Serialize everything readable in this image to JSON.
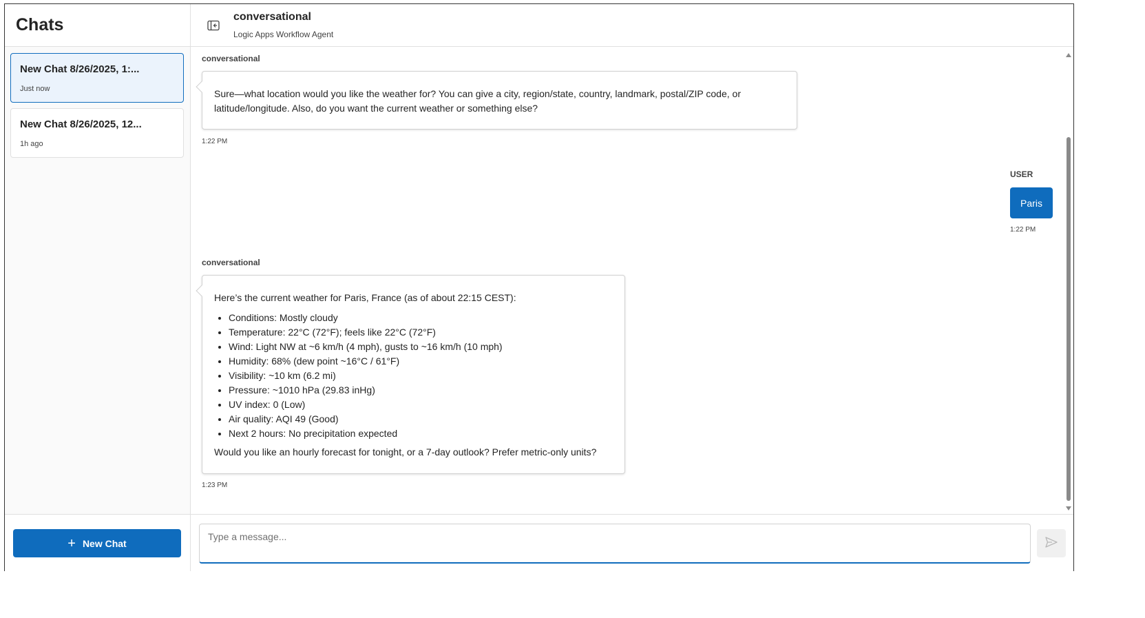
{
  "sidebar": {
    "title": "Chats",
    "chats": [
      {
        "title": "New Chat 8/26/2025, 1:...",
        "time": "Just now",
        "active": true
      },
      {
        "title": "New Chat 8/26/2025, 12...",
        "time": "1h ago",
        "active": false
      }
    ],
    "new_chat_label": "New Chat"
  },
  "header": {
    "title": "conversational",
    "subtitle": "Logic Apps Workflow Agent"
  },
  "messages": [
    {
      "sender": "conversational",
      "text": "Sure—what location would you like the weather for? You can give a city, region/state, country, landmark, postal/ZIP code, or latitude/longitude. Also, do you want the current weather or something else?",
      "time": "1:22 PM"
    },
    {
      "sender": "USER",
      "text": "Paris",
      "time": "1:22 PM"
    },
    {
      "sender": "conversational",
      "intro": "Here’s the current weather for Paris, France (as of about 22:15 CEST):",
      "bullets": [
        "Conditions: Mostly cloudy",
        "Temperature: 22°C (72°F); feels like 22°C (72°F)",
        "Wind: Light NW at ~6 km/h (4 mph), gusts to ~16 km/h (10 mph)",
        "Humidity: 68% (dew point ~16°C / 61°F)",
        "Visibility: ~10 km (6.2 mi)",
        "Pressure: ~1010 hPa (29.83 inHg)",
        "UV index: 0 (Low)",
        "Air quality: AQI 49 (Good)",
        "Next 2 hours: No precipitation expected"
      ],
      "outro": "Would you like an hourly forecast for tonight, or a 7-day outlook? Prefer metric-only units?",
      "time": "1:23 PM"
    }
  ],
  "composer": {
    "placeholder": "Type a message..."
  },
  "icons": {
    "panel_toggle": "panel-collapse-icon",
    "plus": "plus-icon",
    "send": "send-icon"
  },
  "colors": {
    "accent": "#0f6cbd",
    "active_chat_bg": "#ebf3fc"
  }
}
